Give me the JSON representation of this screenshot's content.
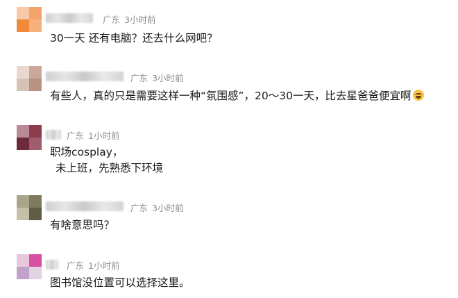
{
  "comments": [
    {
      "location": "广东",
      "time": "3小时前",
      "lines": [
        "30一天 还有电脑？还去什么网吧？"
      ],
      "avatar_colors": [
        "#f7c9a8",
        "#f4a46a",
        "#f08a3a",
        "#f5b07c"
      ]
    },
    {
      "location": "广东",
      "time": "3小时前",
      "lines": [
        "有些人，真的只是需要这样一种“氛围感”，20～30一天，比去星爸爸便宜啊"
      ],
      "emoji": "grinning-sweat-emoji",
      "avatar_colors": [
        "#e8d8cf",
        "#c9a89a",
        "#d7c2b6",
        "#b89384"
      ]
    },
    {
      "location": "广东",
      "time": "1小时前",
      "lines": [
        "职场cosplay，",
        "未上班，先熟悉下环境"
      ],
      "avatar_colors": [
        "#b98a95",
        "#8e3b4e",
        "#6d2a3a",
        "#a15d6d"
      ]
    },
    {
      "location": "广东",
      "time": "3小时前",
      "lines": [
        "有啥意思吗？"
      ],
      "avatar_colors": [
        "#a9a58a",
        "#7f7b5e",
        "#c4bfa6",
        "#615c45"
      ]
    },
    {
      "location": "广东",
      "time": "1小时前",
      "lines": [
        "图书馆没位置可以选择这里。"
      ],
      "avatar_colors": [
        "#e7c7dc",
        "#d64fa0",
        "#bfa1c9",
        "#e0d2e3"
      ]
    }
  ]
}
